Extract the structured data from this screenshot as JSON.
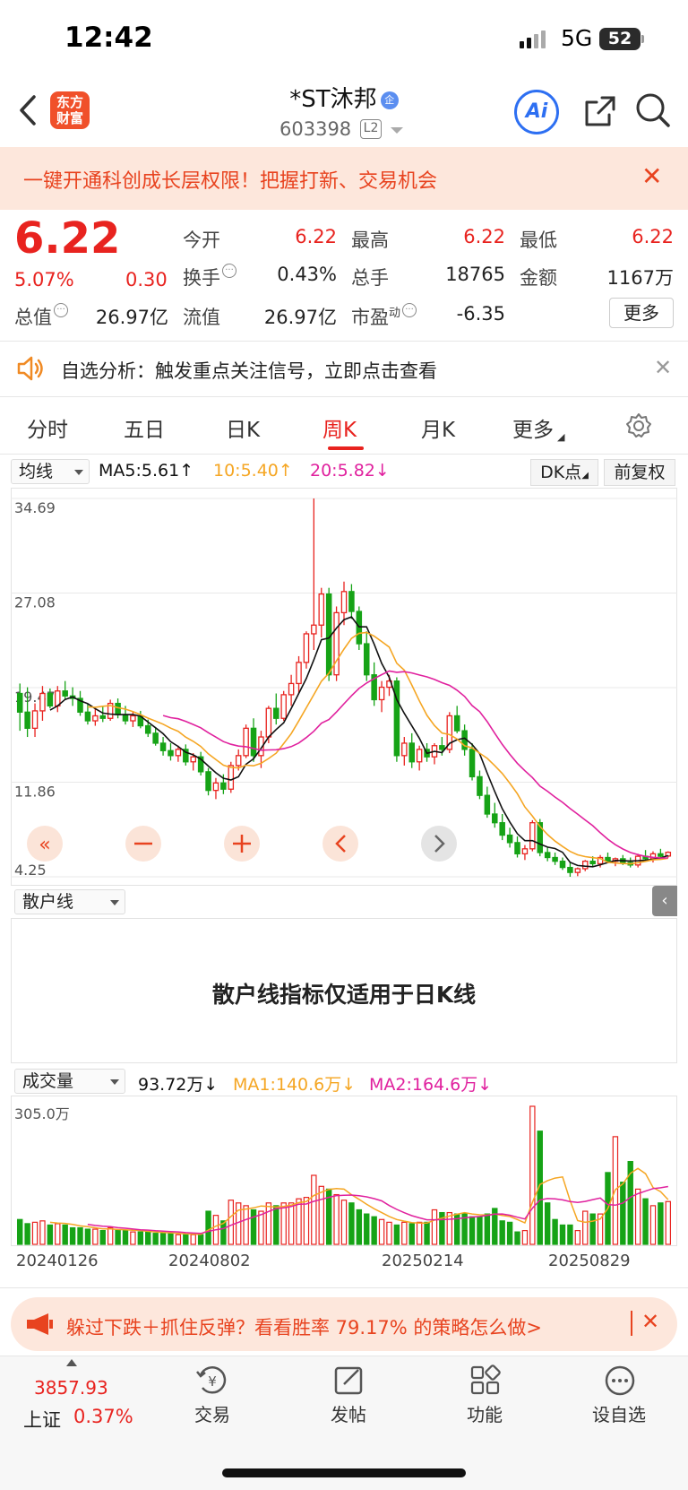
{
  "status_bar": {
    "time": "12:42",
    "network": "5G",
    "battery": "52"
  },
  "header": {
    "logo_text": "东方财富",
    "stock_name": "*ST沐邦",
    "cert_badge": "企",
    "stock_code": "603398",
    "level_badge": "L2",
    "ai_label": "Ai"
  },
  "banner": {
    "text": "一键开通科创成长层权限！把握打新、交易机会",
    "close": "✕"
  },
  "quote": {
    "price": "6.22",
    "change_pct": "5.07%",
    "change": "0.30",
    "rows": [
      [
        {
          "label": "今开",
          "value": "6.22",
          "color": "red"
        },
        {
          "label": "最高",
          "value": "6.22",
          "color": "red"
        },
        {
          "label": "最低",
          "value": "6.22",
          "color": "red"
        }
      ],
      [
        {
          "label": "换手",
          "value": "0.43%",
          "color": "black",
          "info": true
        },
        {
          "label": "总手",
          "value": "18765",
          "color": "black"
        },
        {
          "label": "金额",
          "value": "1167万",
          "color": "black"
        }
      ],
      [
        {
          "label": "总值",
          "value": "26.97亿",
          "color": "black",
          "info": true
        },
        {
          "label": "流值",
          "value": "26.97亿",
          "color": "black"
        },
        {
          "label": "市盈",
          "value": "-6.35",
          "color": "black",
          "sup": "动",
          "info": true
        }
      ]
    ],
    "more": "更多"
  },
  "alert": {
    "text": "自选分析：触发重点关注信号，立即点击查看",
    "close": "✕"
  },
  "tabs": [
    "分时",
    "五日",
    "日K",
    "周K",
    "月K",
    "更多"
  ],
  "active_tab": "周K",
  "kline": {
    "indicator": "均线",
    "ma5": "MA5:5.61",
    "ma10": "10:5.40",
    "ma20": "20:5.82",
    "ma5_arrow": "↑",
    "ma10_arrow": "↑",
    "ma20_arrow": "↓",
    "dk_label": "DK点",
    "adjust": "前复权",
    "y_labels": [
      "34.69",
      "27.08",
      "19.47",
      "11.86",
      "4.25"
    ],
    "colors": {
      "up": "#e8231f",
      "down": "#16a316",
      "ma5": "#111111",
      "ma10": "#f5a623",
      "ma20": "#e0219e"
    }
  },
  "retail": {
    "indicator": "散户线",
    "message": "散户线指标仅适用于日K线"
  },
  "volume": {
    "indicator": "成交量",
    "vol": "93.72万",
    "vol_arrow": "↓",
    "ma1": "MA1:140.6万",
    "ma1_arrow": "↓",
    "ma2": "MA2:164.6万",
    "ma2_arrow": "↓",
    "max_label": "305.0万",
    "dates": [
      "20240126",
      "20240802",
      "20250214",
      "20250829"
    ]
  },
  "ad": {
    "text": "躲过下跌＋抓住反弹？看看胜率 79.17% 的策略怎么做>",
    "close": "✕"
  },
  "bottom_nav": {
    "index_value": "3857.93",
    "index_name": "上证",
    "index_pct": "0.37%",
    "items": [
      "交易",
      "发帖",
      "功能",
      "设自选"
    ]
  },
  "chart_data": {
    "type": "candlestick",
    "period": "weekly",
    "ylim": [
      4.25,
      34.69
    ],
    "candles": [
      [
        19.0,
        19.8,
        16.0,
        17.5,
        0.18
      ],
      [
        17.5,
        19.5,
        15.5,
        16.2,
        0.15
      ],
      [
        16.2,
        18.2,
        15.5,
        17.6,
        0.16
      ],
      [
        17.6,
        19.6,
        16.8,
        19.0,
        0.17
      ],
      [
        19.0,
        19.4,
        17.8,
        18.0,
        0.14
      ],
      [
        18.0,
        19.6,
        17.5,
        19.2,
        0.15
      ],
      [
        19.2,
        20.0,
        18.5,
        18.8,
        0.14
      ],
      [
        18.8,
        19.5,
        18.0,
        18.6,
        0.12
      ],
      [
        18.6,
        19.2,
        17.2,
        17.5,
        0.12
      ],
      [
        17.5,
        18.2,
        16.5,
        16.8,
        0.11
      ],
      [
        16.8,
        17.8,
        16.4,
        17.2,
        0.11
      ],
      [
        17.2,
        18.0,
        16.7,
        17.0,
        0.1
      ],
      [
        17.0,
        18.5,
        16.8,
        18.2,
        0.12
      ],
      [
        18.2,
        18.6,
        17.0,
        17.3,
        0.1
      ],
      [
        17.3,
        18.0,
        16.5,
        16.8,
        0.1
      ],
      [
        16.8,
        17.5,
        16.3,
        17.2,
        0.09
      ],
      [
        17.2,
        17.6,
        16.2,
        16.4,
        0.09
      ],
      [
        16.4,
        16.9,
        15.5,
        15.8,
        0.09
      ],
      [
        15.8,
        16.2,
        14.8,
        15.0,
        0.08
      ],
      [
        15.0,
        15.5,
        14.0,
        14.4,
        0.08
      ],
      [
        14.4,
        15.0,
        13.6,
        14.0,
        0.08
      ],
      [
        14.0,
        14.8,
        13.5,
        14.5,
        0.07
      ],
      [
        14.5,
        14.9,
        13.2,
        13.5,
        0.07
      ],
      [
        13.5,
        14.2,
        12.8,
        13.9,
        0.07
      ],
      [
        13.9,
        14.3,
        12.4,
        12.7,
        0.07
      ],
      [
        12.7,
        13.0,
        10.8,
        11.2,
        0.24
      ],
      [
        11.2,
        12.2,
        10.5,
        11.8,
        0.21
      ],
      [
        11.8,
        12.5,
        10.9,
        11.3,
        0.17
      ],
      [
        11.3,
        13.5,
        11.0,
        13.2,
        0.32
      ],
      [
        13.2,
        14.5,
        12.8,
        14.0,
        0.3
      ],
      [
        14.0,
        16.5,
        13.8,
        16.2,
        0.28
      ],
      [
        16.2,
        17.0,
        13.5,
        14.0,
        0.25
      ],
      [
        14.0,
        16.0,
        13.0,
        15.5,
        0.24
      ],
      [
        15.5,
        18.0,
        15.0,
        17.8,
        0.3
      ],
      [
        17.8,
        19.0,
        16.5,
        17.0,
        0.28
      ],
      [
        17.0,
        19.2,
        16.8,
        18.9,
        0.3
      ],
      [
        18.9,
        20.5,
        18.0,
        19.8,
        0.3
      ],
      [
        19.8,
        22.0,
        19.0,
        21.5,
        0.33
      ],
      [
        21.5,
        24.0,
        21.0,
        23.8,
        0.34
      ],
      [
        23.8,
        34.69,
        22.5,
        24.5,
        0.5
      ],
      [
        24.5,
        27.5,
        23.5,
        27.0,
        0.42
      ],
      [
        27.0,
        27.5,
        20.0,
        20.5,
        0.4
      ],
      [
        20.5,
        26.0,
        20.0,
        25.5,
        0.36
      ],
      [
        25.5,
        28.0,
        24.5,
        27.2,
        0.32
      ],
      [
        27.2,
        27.8,
        25.0,
        25.6,
        0.3
      ],
      [
        25.6,
        26.0,
        22.5,
        23.0,
        0.25
      ],
      [
        23.0,
        24.0,
        20.0,
        20.5,
        0.22
      ],
      [
        20.5,
        21.5,
        18.0,
        18.5,
        0.2
      ],
      [
        18.5,
        20.0,
        17.5,
        19.5,
        0.18
      ],
      [
        19.5,
        20.5,
        18.8,
        20.0,
        0.16
      ],
      [
        20.0,
        20.3,
        13.5,
        14.0,
        0.14
      ],
      [
        14.0,
        15.5,
        13.2,
        15.0,
        0.16
      ],
      [
        15.0,
        15.8,
        13.0,
        13.5,
        0.15
      ],
      [
        13.5,
        14.8,
        12.8,
        14.5,
        0.16
      ],
      [
        14.5,
        15.0,
        13.5,
        13.9,
        0.16
      ],
      [
        13.9,
        15.0,
        13.3,
        14.8,
        0.25
      ],
      [
        14.8,
        15.5,
        14.0,
        14.5,
        0.23
      ],
      [
        14.5,
        17.5,
        14.2,
        17.2,
        0.23
      ],
      [
        17.2,
        18.0,
        15.8,
        16.0,
        0.22
      ],
      [
        16.0,
        16.5,
        14.0,
        14.5,
        0.22
      ],
      [
        14.5,
        15.0,
        12.0,
        12.3,
        0.2
      ],
      [
        12.3,
        12.8,
        10.5,
        10.8,
        0.2
      ],
      [
        10.8,
        11.5,
        9.0,
        9.3,
        0.22
      ],
      [
        9.3,
        10.2,
        8.2,
        8.6,
        0.26
      ],
      [
        8.6,
        9.3,
        7.2,
        7.6,
        0.17
      ],
      [
        7.6,
        8.2,
        6.6,
        7.0,
        0.16
      ],
      [
        7.0,
        7.5,
        5.8,
        6.1,
        0.09
      ],
      [
        6.1,
        6.8,
        5.6,
        6.5,
        0.1
      ],
      [
        6.5,
        8.8,
        6.3,
        8.6,
        1.0
      ],
      [
        8.6,
        8.9,
        5.9,
        6.2,
        0.82
      ],
      [
        6.2,
        6.6,
        5.5,
        5.8,
        0.3
      ],
      [
        5.8,
        6.2,
        5.2,
        5.5,
        0.18
      ],
      [
        5.5,
        5.8,
        4.8,
        5.0,
        0.14
      ],
      [
        5.0,
        5.4,
        4.25,
        4.6,
        0.14
      ],
      [
        4.6,
        5.0,
        4.3,
        4.9,
        0.1
      ],
      [
        4.9,
        5.6,
        4.7,
        5.5,
        0.24
      ],
      [
        5.5,
        5.9,
        5.1,
        5.3,
        0.22
      ],
      [
        5.3,
        6.0,
        5.0,
        5.8,
        0.22
      ],
      [
        5.8,
        6.2,
        5.4,
        5.5,
        0.52
      ],
      [
        5.5,
        5.8,
        5.1,
        5.7,
        0.78
      ],
      [
        5.7,
        6.0,
        5.2,
        5.4,
        0.45
      ],
      [
        5.4,
        5.8,
        5.0,
        5.2,
        0.6
      ],
      [
        5.2,
        6.1,
        5.0,
        5.9,
        0.4
      ],
      [
        5.9,
        6.4,
        5.5,
        5.7,
        0.33
      ],
      [
        5.7,
        6.3,
        5.4,
        6.1,
        0.28
      ],
      [
        6.1,
        6.5,
        5.8,
        5.9,
        0.3
      ],
      [
        5.92,
        6.3,
        5.8,
        6.22,
        0.31
      ]
    ],
    "volume_unit": "fraction of 305.0万",
    "series": [
      {
        "name": "MA5"
      },
      {
        "name": "10"
      },
      {
        "name": "20"
      },
      {
        "name": "MA1"
      },
      {
        "name": "MA2"
      }
    ]
  }
}
